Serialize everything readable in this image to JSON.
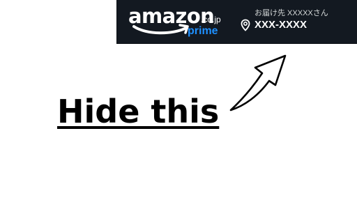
{
  "header": {
    "background_color": "#131921",
    "logo": {
      "brand": "amazon",
      "domain": ".co.jp",
      "tier": "prime",
      "smile_color": "#ffffff",
      "tier_color": "#1e90ff"
    },
    "delivery": {
      "label": "お届け先 XXXXXさん",
      "postal_code": "XXX-XXXX",
      "icon": "location-pin-icon"
    }
  },
  "annotation": {
    "text": "Hide this",
    "arrow_icon": "curved-arrow-up-right-icon",
    "color": "#000000"
  }
}
